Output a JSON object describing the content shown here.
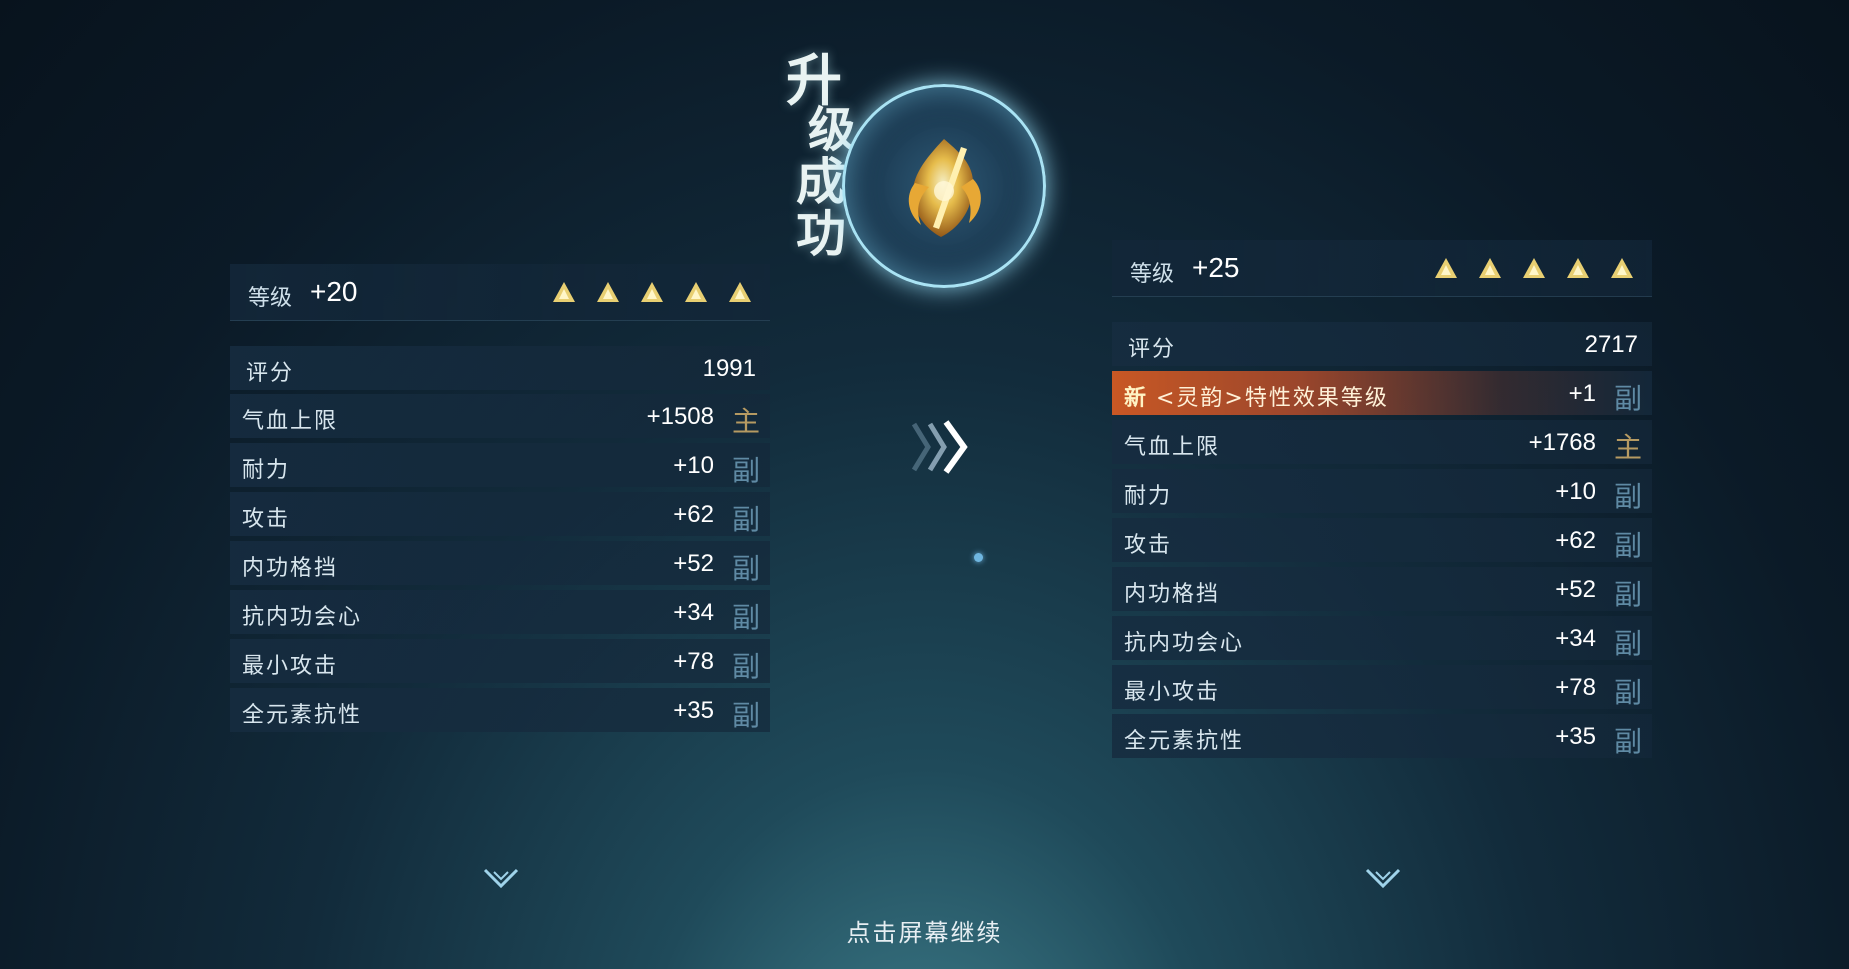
{
  "title": {
    "chars": [
      "升",
      "级",
      "成",
      "功"
    ]
  },
  "left_panel": {
    "level_label": "等级",
    "level_value": "+20",
    "score_label": "评分",
    "score_value": "1991",
    "stats": [
      {
        "label": "气血上限",
        "value": "+1508",
        "tag": "主",
        "tag_type": "main"
      },
      {
        "label": "耐力",
        "value": "+10",
        "tag": "副",
        "tag_type": "sub"
      },
      {
        "label": "攻击",
        "value": "+62",
        "tag": "副",
        "tag_type": "sub"
      },
      {
        "label": "内功格挡",
        "value": "+52",
        "tag": "副",
        "tag_type": "sub"
      },
      {
        "label": "抗内功会心",
        "value": "+34",
        "tag": "副",
        "tag_type": "sub"
      },
      {
        "label": "最小攻击",
        "value": "+78",
        "tag": "副",
        "tag_type": "sub"
      },
      {
        "label": "全元素抗性",
        "value": "+35",
        "tag": "副",
        "tag_type": "sub"
      }
    ]
  },
  "right_panel": {
    "level_label": "等级",
    "level_value": "+25",
    "score_label": "评分",
    "score_value": "2717",
    "new_stat": {
      "badge": "新",
      "label": "<灵韵>特性效果等级",
      "value": "+1",
      "tag": "副"
    },
    "stats": [
      {
        "label": "气血上限",
        "value": "+1768",
        "tag": "主",
        "tag_type": "main"
      },
      {
        "label": "耐力",
        "value": "+10",
        "tag": "副",
        "tag_type": "sub"
      },
      {
        "label": "攻击",
        "value": "+62",
        "tag": "副",
        "tag_type": "sub"
      },
      {
        "label": "内功格挡",
        "value": "+52",
        "tag": "副",
        "tag_type": "sub"
      },
      {
        "label": "抗内功会心",
        "value": "+34",
        "tag": "副",
        "tag_type": "sub"
      },
      {
        "label": "最小攻击",
        "value": "+78",
        "tag": "副",
        "tag_type": "sub"
      },
      {
        "label": "全元素抗性",
        "value": "+35",
        "tag": "副",
        "tag_type": "sub"
      }
    ]
  },
  "footer": {
    "continue_text": "点击屏幕继续"
  },
  "icons": {
    "star": "gold-triangle-star-icon",
    "orb": "golden-flame-emblem-icon",
    "arrows": "triple-chevron-right-icon",
    "expand": "chevron-down-icon"
  },
  "colors": {
    "main_tag": "#b69a62",
    "sub_tag": "#5f8aa4",
    "new_highlight": "#d25a23",
    "orb_ring": "#a9e3f4"
  }
}
